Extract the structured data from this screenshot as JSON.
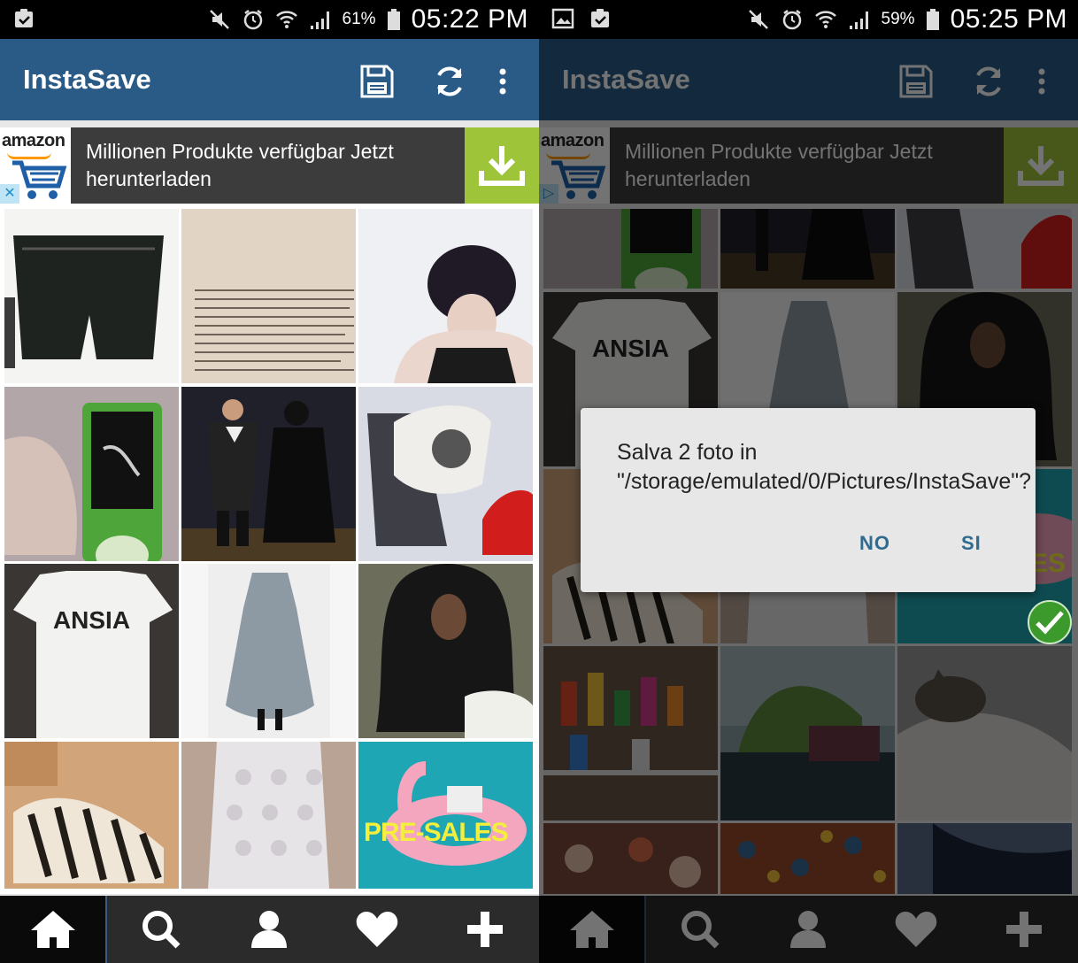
{
  "screens": [
    {
      "id": "left",
      "status": {
        "battery_pct": "61%",
        "time": "05:22 PM"
      },
      "app": {
        "title": "InstaSave"
      },
      "ad": {
        "brand": "amazon",
        "text": "Millionen Produkte verfügbar Jetzt herunterladen",
        "close": "✕"
      }
    },
    {
      "id": "right",
      "status": {
        "battery_pct": "59%",
        "time": "05:25 PM"
      },
      "app": {
        "title": "InstaSave"
      },
      "ad": {
        "brand": "amazon",
        "text": "Millionen Produkte verfügbar Jetzt herunterladen",
        "close": "▷"
      },
      "dialog": {
        "message": "Salva 2 foto in \"/storage/emulated/0/Pictures/InstaSave\"?",
        "no_label": "NO",
        "yes_label": "SI"
      }
    }
  ],
  "photos_left": [
    {
      "name": "photo-shorts",
      "caption": ""
    },
    {
      "name": "photo-book-page",
      "caption": ""
    },
    {
      "name": "photo-bowl-haircut",
      "caption": ""
    },
    {
      "name": "photo-ipod-nano",
      "caption": ""
    },
    {
      "name": "photo-costume-couple",
      "caption": ""
    },
    {
      "name": "photo-bulls-cap",
      "caption": ""
    },
    {
      "name": "photo-ansia-shirt",
      "caption": "ANSIA"
    },
    {
      "name": "photo-grey-dress",
      "caption": ""
    },
    {
      "name": "photo-long-hair-man",
      "caption": ""
    },
    {
      "name": "photo-zebra-shoes",
      "caption": ""
    },
    {
      "name": "photo-lace-top",
      "caption": ""
    },
    {
      "name": "photo-flamingo-pool",
      "caption": "PRE-SALES"
    }
  ],
  "photos_right": [
    {
      "name": "photo-ipod-nano",
      "caption": ""
    },
    {
      "name": "photo-costume-couple",
      "caption": ""
    },
    {
      "name": "photo-bulls-cap",
      "caption": ""
    },
    {
      "name": "photo-ansia-shirt",
      "caption": "ANSIA"
    },
    {
      "name": "photo-grey-dress",
      "caption": ""
    },
    {
      "name": "photo-long-hair-man",
      "caption": ""
    },
    {
      "name": "photo-zebra-shoes",
      "caption": ""
    },
    {
      "name": "photo-lace-top",
      "caption": ""
    },
    {
      "name": "photo-flamingo-pool",
      "caption": "ES"
    },
    {
      "name": "photo-candy-shelves",
      "caption": ""
    },
    {
      "name": "photo-river-willows",
      "caption": ""
    },
    {
      "name": "photo-cat-on-bed",
      "caption": ""
    },
    {
      "name": "photo-floral-pattern",
      "caption": ""
    },
    {
      "name": "photo-patterned-fabric",
      "caption": ""
    },
    {
      "name": "photo-dark-portrait",
      "caption": ""
    }
  ],
  "nav": [
    {
      "name": "nav-home",
      "icon": "home-icon"
    },
    {
      "name": "nav-search",
      "icon": "search-icon"
    },
    {
      "name": "nav-profile",
      "icon": "person-icon"
    },
    {
      "name": "nav-likes",
      "icon": "heart-icon"
    },
    {
      "name": "nav-add",
      "icon": "plus-icon"
    }
  ],
  "colors": {
    "appbar": "#2a5b87",
    "ad_button": "#9ec43a",
    "dialog_button": "#2f6a8f",
    "selected_check": "#3b9a2b"
  }
}
